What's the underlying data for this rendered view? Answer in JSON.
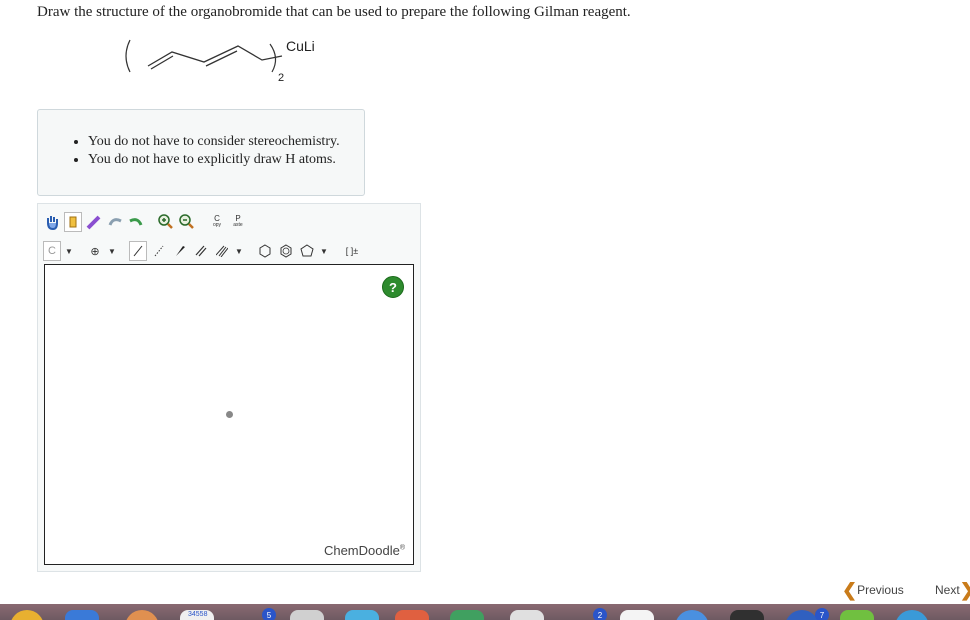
{
  "question": {
    "text": "Draw the structure of the organobromide that can be used to prepare the following Gilman reagent."
  },
  "structure": {
    "reagent_label": "CuLi",
    "subscript": "2"
  },
  "notes": {
    "items": [
      "You do not have to consider stereochemistry.",
      "You do not have to explicitly draw H atoms."
    ]
  },
  "editor": {
    "toolbar_row1": [
      {
        "name": "hand-icon"
      },
      {
        "name": "eraser-icon"
      },
      {
        "name": "lasso-icon"
      },
      {
        "name": "undo-icon"
      },
      {
        "name": "redo-icon"
      },
      {
        "name": "zoom-in-icon"
      },
      {
        "name": "zoom-out-icon"
      }
    ],
    "copy_label": "C",
    "copy_sub": "opy",
    "paste_label": "P",
    "paste_sub": "aste",
    "atom_label": "C",
    "charge_label": "⊕",
    "bracket_label": "[ ]±",
    "brand": "ChemDoodle",
    "brand_mark": "®",
    "help_label": "?"
  },
  "navigation": {
    "previous": "Previous",
    "next": "Next"
  },
  "dock": {
    "badges": [
      "2",
      "7",
      "5"
    ],
    "partial_label": "34558"
  },
  "colors": {
    "accent_orange": "#c97b1a",
    "help_green": "#2e8b2e"
  }
}
